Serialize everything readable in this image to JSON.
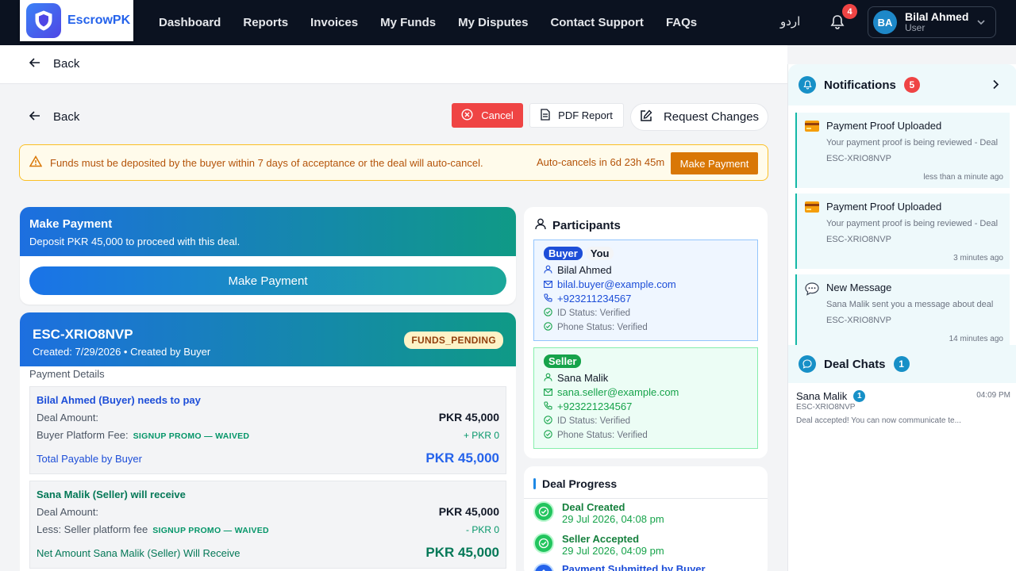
{
  "brand": {
    "name": "EscrowPK"
  },
  "nav": {
    "links": [
      "Dashboard",
      "Reports",
      "Invoices",
      "My Funds",
      "My Disputes",
      "Contact Support",
      "FAQs"
    ],
    "lang": "اردو",
    "bell_count": "4",
    "user": {
      "initials": "BA",
      "name": "Bilal Ahmed",
      "role": "User"
    }
  },
  "page": {
    "back_top": "Back",
    "back_inner": "Back"
  },
  "toolbar": {
    "cancel": "Cancel",
    "pdf": "PDF Report",
    "request": "Request Changes"
  },
  "alert": {
    "text": "Funds must be deposited by the buyer within 7 days of acceptance or the deal will auto-cancel.",
    "timer": "Auto-cancels in 6d 23h 45m",
    "button": "Make Payment"
  },
  "make_payment": {
    "title": "Make Payment",
    "subtitle": "Deposit PKR 45,000 to proceed with this deal.",
    "button": "Make Payment"
  },
  "deal": {
    "id": "ESC-XRIO8NVP",
    "created": "Created: 7/29/2026 • Created by Buyer",
    "status": "FUNDS_PENDING",
    "payment_details_label": "Payment Details",
    "buyer_box": {
      "title": "Bilal Ahmed (Buyer) needs to pay",
      "deal_amount_label": "Deal Amount:",
      "deal_amount": "PKR 45,000",
      "fee_label": "Buyer Platform Fee:",
      "fee_promo": "SIGNUP PROMO — WAIVED",
      "fee_value": "+ PKR 0",
      "total_label": "Total Payable by Buyer",
      "total_value": "PKR 45,000"
    },
    "seller_box": {
      "title": "Sana Malik (Seller) will receive",
      "deal_amount_label": "Deal Amount:",
      "deal_amount": "PKR 45,000",
      "fee_label": "Less: Seller platform fee",
      "fee_promo": "SIGNUP PROMO — WAIVED",
      "fee_value": "- PKR 0",
      "total_label": "Net Amount Sana Malik (Seller) Will Receive",
      "total_value": "PKR 45,000"
    }
  },
  "participants": {
    "title": "Participants",
    "buyer": {
      "role": "Buyer",
      "you": "You",
      "name": "Bilal Ahmed",
      "email": "bilal.buyer@example.com",
      "phone": "+923211234567",
      "id_status": "ID Status: Verified",
      "phone_status": "Phone Status: Verified"
    },
    "seller": {
      "role": "Seller",
      "name": "Sana Malik",
      "email": "sana.seller@example.com",
      "phone": "+923221234567",
      "id_status": "ID Status: Verified",
      "phone_status": "Phone Status: Verified"
    }
  },
  "progress": {
    "title": "Deal Progress",
    "steps": [
      {
        "title": "Deal Created",
        "date": "29 Jul 2026, 04:08 pm"
      },
      {
        "title": "Seller Accepted",
        "date": "29 Jul 2026, 04:09 pm"
      },
      {
        "title": "Payment Submitted by Buyer",
        "date": ""
      }
    ]
  },
  "notifications": {
    "title": "Notifications",
    "count": "5",
    "items": [
      {
        "title": "Payment Proof Uploaded",
        "body": "Your payment proof is being reviewed - Deal ESC-XRIO8NVP",
        "time": "less than a minute ago",
        "icon": "card-icon"
      },
      {
        "title": "Payment Proof Uploaded",
        "body": "Your payment proof is being reviewed - Deal ESC-XRIO8NVP",
        "time": "3 minutes ago",
        "icon": "card-icon"
      },
      {
        "title": "New Message",
        "body": "Sana Malik sent you a message about deal ESC-XRIO8NVP",
        "time": "14 minutes ago",
        "icon": "message-icon"
      }
    ]
  },
  "chats": {
    "title": "Deal Chats",
    "count": "1",
    "items": [
      {
        "name": "Sana Malik",
        "unread": "1",
        "time": "04:09 PM",
        "deal": "ESC-XRIO8NVP",
        "preview": "Deal accepted! You can now communicate te..."
      }
    ]
  },
  "colors": {
    "accent": "#2563eb",
    "danger": "#ef4444",
    "warning": "#d97706",
    "success": "#15803d",
    "teal": "#0f9a86"
  }
}
